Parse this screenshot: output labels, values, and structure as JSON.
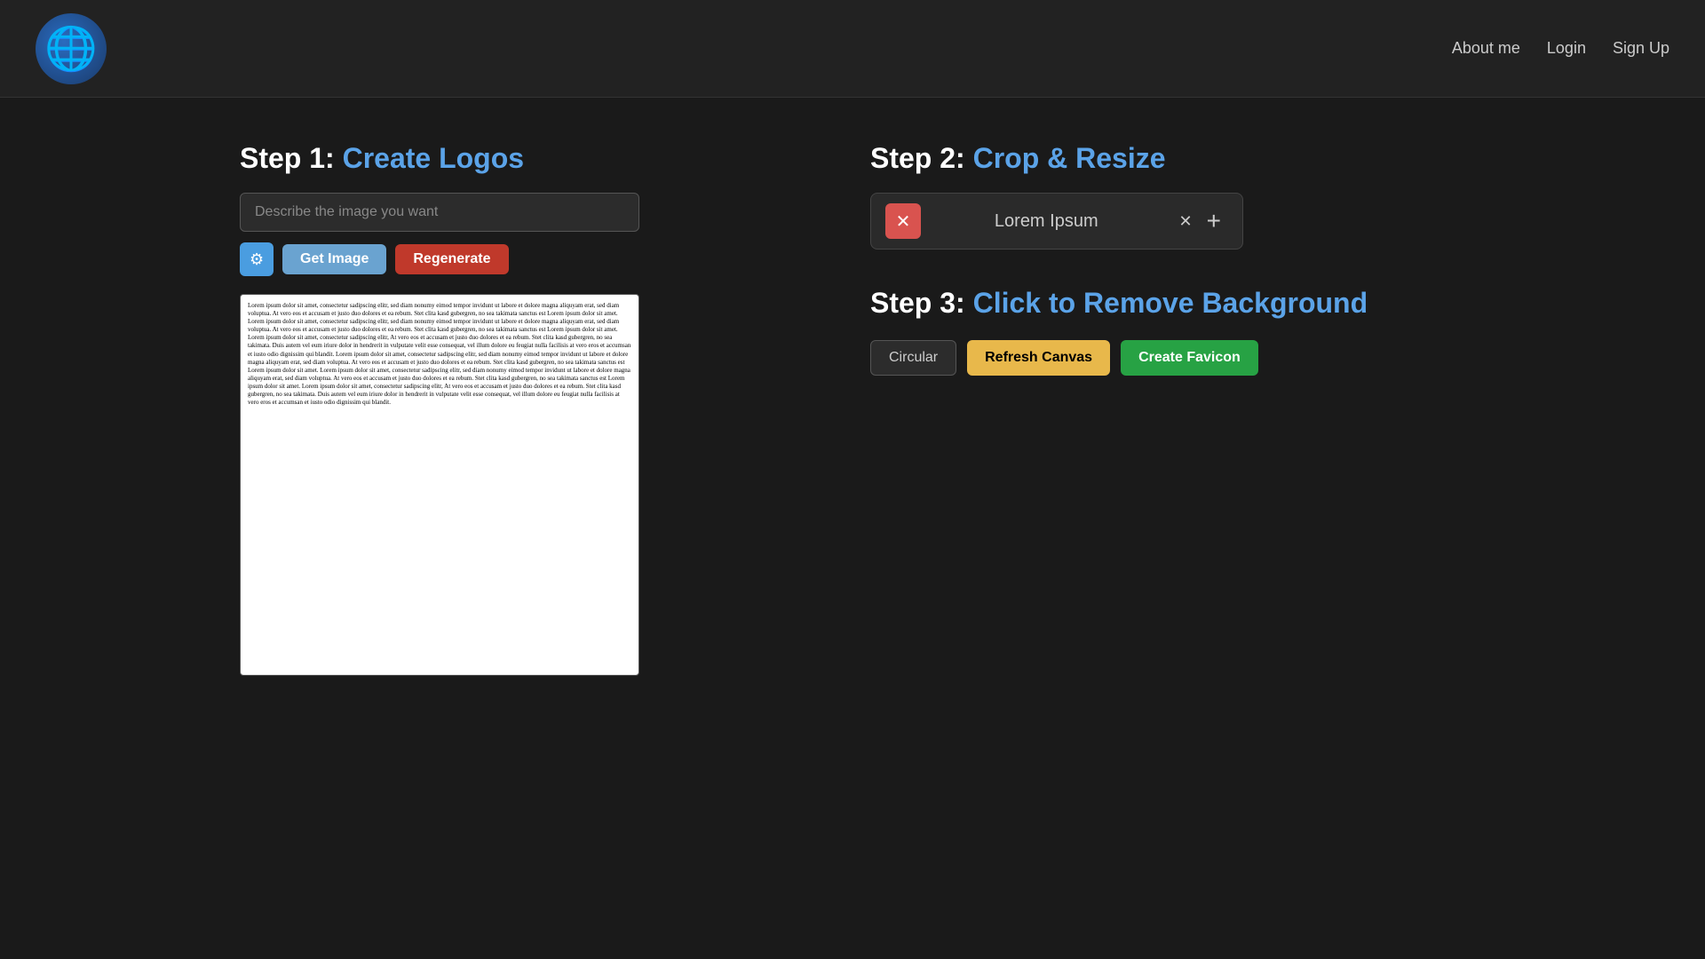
{
  "navbar": {
    "logo_emoji": "🌐",
    "links": [
      {
        "id": "about-me",
        "label": "About me"
      },
      {
        "id": "login",
        "label": "Login"
      },
      {
        "id": "sign-up",
        "label": "Sign Up"
      }
    ]
  },
  "step1": {
    "label": "Step 1:",
    "title": "Create Logos",
    "input_placeholder": "Describe the image you want",
    "get_image_label": "Get Image",
    "regenerate_label": "Regenerate",
    "settings_icon": "⚙"
  },
  "step2": {
    "label": "Step 2:",
    "title": "Crop & Resize",
    "crop_text": "Lorem Ipsum",
    "remove_icon": "✕",
    "close_icon": "✕",
    "plus_icon": "+"
  },
  "step3": {
    "label": "Step 3:",
    "title": "Click to Remove Background",
    "circular_label": "Circular",
    "refresh_label": "Refresh Canvas",
    "create_favicon_label": "Create Favicon"
  },
  "lorem_ipsum": "Lorem ipsum dolor sit amet, consectetur sadipscing elitr, sed diam nonumy eimod tempor invidunt ut labore et dolore magna aliquyam erat, sed diam voluptua. At vero eos et accusam et justo duo dolores et ea rebum. Stet clita kasd gubergren, no sea takimata sanctus est Lorem ipsum dolor sit amet. Lorem ipsum dolor sit amet, consectetur sadipscing elitr, sed diam nonumy eimod tempor invidunt ut labore et dolore magna aliquyam erat, sed diam voluptua. At vero eos et accusam et justo duo dolores et ea rebum. Stet clita kasd gubergren, no sea takimata sanctus est Lorem ipsum dolor sit amet. Lorem ipsum dolor sit amet, consectetur sadipscing elitr, At vero eos et accusam et justo duo dolores et ea rebum. Stet clita kasd gubergren, no sea takimata. Duis autem vel eum iriure dolor in hendrerit in vulputate velit esse consequat, vel illum dolore eu feugiat nulla facilisis at vero eros et accumsan et iusto odio dignissim qui blandit. Lorem ipsum dolor sit amet, consectetur sadipscing elitr, sed diam nonumy eimod tempor invidunt ut labore et dolore magna aliquyam erat, sed diam voluptua. At vero eos et accusam et justo duo dolores et ea rebum. Stet clita kasd gubergren, no sea takimata sanctus est Lorem ipsum dolor sit amet. Lorem ipsum dolor sit amet, consectetur sadipscing elitr, sed diam nonumy eimod tempor invidunt ut labore et dolore magna aliquyam erat, sed diam voluptua. At vero eos et accusam et justo duo dolores et ea rebum. Stet clita kasd gubergren, no sea takimata sanctus est Lorem ipsum dolor sit amet. Lorem ipsum dolor sit amet, consectetur sadipscing elitr, At vero eos et accusam et justo duo dolores et ea rebum. Stet clita kasd gubergren, no sea takimata. Duis autem vel eum iriure dolor in hendrerit in vulputate velit esse consequat, vel illum dolore eu feugiat nulla facilisis at vero eros et accumsan et iusto odio dignissim qui blandit."
}
